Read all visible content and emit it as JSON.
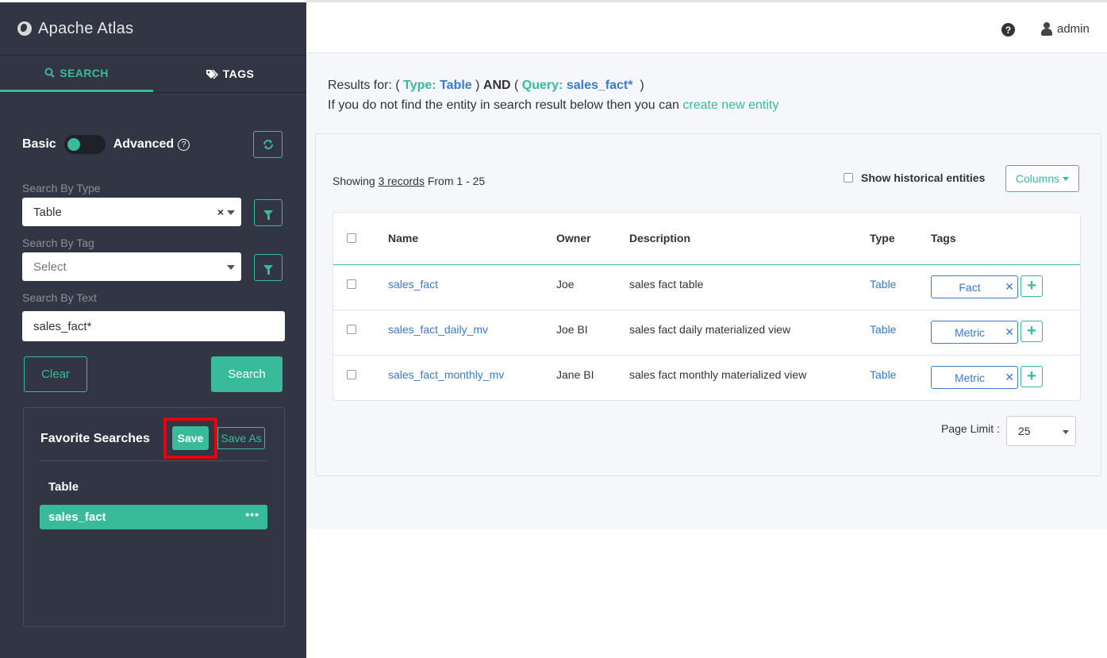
{
  "app": {
    "title": "Apache Atlas"
  },
  "sidebar": {
    "tabs": [
      {
        "label": "SEARCH",
        "icon": "search-icon"
      },
      {
        "label": "TAGS",
        "icon": "tag-icon"
      }
    ],
    "mode": {
      "basic_label": "Basic",
      "advanced_label": "Advanced",
      "advanced_enabled": false
    },
    "search_by_type": {
      "label": "Search By Type",
      "value": "Table"
    },
    "search_by_tag": {
      "label": "Search By Tag",
      "placeholder": "Select"
    },
    "search_by_text": {
      "label": "Search By Text",
      "value": "sales_fact*"
    },
    "clear_label": "Clear",
    "search_label": "Search",
    "favorites": {
      "title": "Favorite Searches",
      "save_label": "Save",
      "save_as_label": "Save As",
      "group": "Table",
      "items": [
        {
          "label": "sales_fact"
        }
      ]
    }
  },
  "topbar": {
    "user": "admin"
  },
  "results": {
    "prefix": "Results for:",
    "type_key": "Type:",
    "type_value": "Table",
    "and_text": "AND",
    "query_key": "Query:",
    "query_value": "sales_fact*",
    "info_text": "If you do not find the entity in search result below then you can",
    "create_link": "create new entity",
    "showing_prefix": "Showing",
    "records_link": "3 records",
    "range": "From 1 - 25",
    "historical_label": "Show historical entities",
    "columns_label": "Columns"
  },
  "table": {
    "headers": {
      "name": "Name",
      "owner": "Owner",
      "description": "Description",
      "type": "Type",
      "tags": "Tags"
    },
    "rows": [
      {
        "name": "sales_fact",
        "owner": "Joe",
        "description": "sales fact table",
        "type": "Table",
        "tag": "Fact"
      },
      {
        "name": "sales_fact_daily_mv",
        "owner": "Joe BI",
        "description": "sales fact daily materialized view",
        "type": "Table",
        "tag": "Metric"
      },
      {
        "name": "sales_fact_monthly_mv",
        "owner": "Jane BI",
        "description": "sales fact monthly materialized view",
        "type": "Table",
        "tag": "Metric"
      }
    ]
  },
  "pagination": {
    "label": "Page Limit :",
    "value": "25"
  },
  "colors": {
    "accent": "#37bb9b",
    "link": "#3a7ad1",
    "sidebar_bg": "#323544",
    "highlight": "#e8000b"
  }
}
